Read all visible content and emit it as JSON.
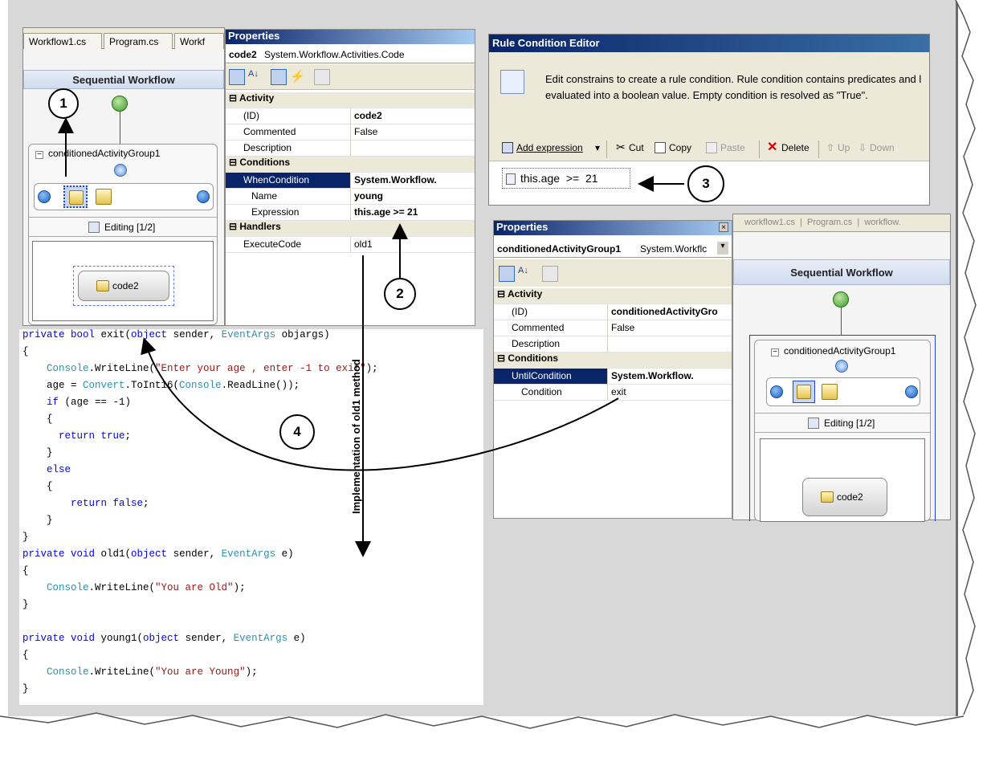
{
  "designer_left": {
    "tabs": [
      "Workflow1.cs",
      "Program.cs",
      "Workf"
    ],
    "header": "Sequential Workflow",
    "group_label": "conditionedActivityGroup1",
    "editing_label": "Editing [1/2]",
    "activity_label": "code2"
  },
  "properties_top": {
    "title": "Properties",
    "object_name": "code2",
    "object_type": "System.Workflow.Activities.Code",
    "categories": {
      "activity": "Activity",
      "conditions": "Conditions",
      "handlers": "Handlers"
    },
    "rows": [
      {
        "name": "(ID)",
        "value": "code2"
      },
      {
        "name": "Commented",
        "value": "False"
      },
      {
        "name": "Description",
        "value": ""
      },
      {
        "name": "WhenCondition",
        "value": "System.Workflow."
      },
      {
        "name": "Name",
        "value": "young"
      },
      {
        "name": "Expression",
        "value": "this.age >= 21"
      },
      {
        "name": "ExecuteCode",
        "value": "old1"
      }
    ]
  },
  "rule_editor": {
    "title": "Rule Condition Editor",
    "description": "Edit constrains to create a rule condition. Rule condition contains predicates and l evaluated into a boolean value. Empty condition is resolved as \"True\".",
    "description_line1": "Edit constrains to create a rule condition. Rule condition contains predicates and l",
    "description_line2": "evaluated into a boolean value. Empty condition is resolved as \"True\".",
    "toolbar": {
      "add_expression": "Add expression",
      "cut": "Cut",
      "copy": "Copy",
      "paste": "Paste",
      "delete": "Delete",
      "up": "Up",
      "down": "Down"
    },
    "expression": "this.age  >=  21"
  },
  "properties_right": {
    "title": "Properties",
    "object_name": "conditionedActivityGroup1",
    "object_type": "System.Workflc",
    "categories": {
      "activity": "Activity",
      "conditions": "Conditions"
    },
    "rows": [
      {
        "name": "(ID)",
        "value": "conditionedActivityGro"
      },
      {
        "name": "Commented",
        "value": "False"
      },
      {
        "name": "Description",
        "value": ""
      },
      {
        "name": "UntilCondition",
        "value": "System.Workflow."
      },
      {
        "name": "Condition",
        "value": "exit"
      }
    ]
  },
  "designer_right": {
    "tabs_text": "workflow1.cs  |  Program.cs  |  workflow.",
    "header": "Sequential Workflow",
    "group_label": "conditionedActivityGroup1",
    "editing_label": "Editing [1/2]",
    "activity_label": "code2"
  },
  "callouts": {
    "one": "1",
    "two": "2",
    "three": "3",
    "four": "4",
    "vertical_label": "Implementation of old1 method"
  },
  "code_lines": [
    "private bool exit(object sender, EventArgs objargs)",
    "{",
    "    Console.WriteLine(\"Enter your age , enter -1 to exit\");",
    "    age = Convert.ToInt16(Console.ReadLine());",
    "    if (age == -1)",
    "    {",
    "      return true;",
    "    }",
    "    else",
    "    {",
    "        return false;",
    "    }",
    "}",
    "private void old1(object sender, EventArgs e)",
    "{",
    "    Console.WriteLine(\"You are Old\");",
    "}",
    "",
    "private void young1(object sender, EventArgs e)",
    "{",
    "    Console.WriteLine(\"You are Young\");",
    "}"
  ]
}
